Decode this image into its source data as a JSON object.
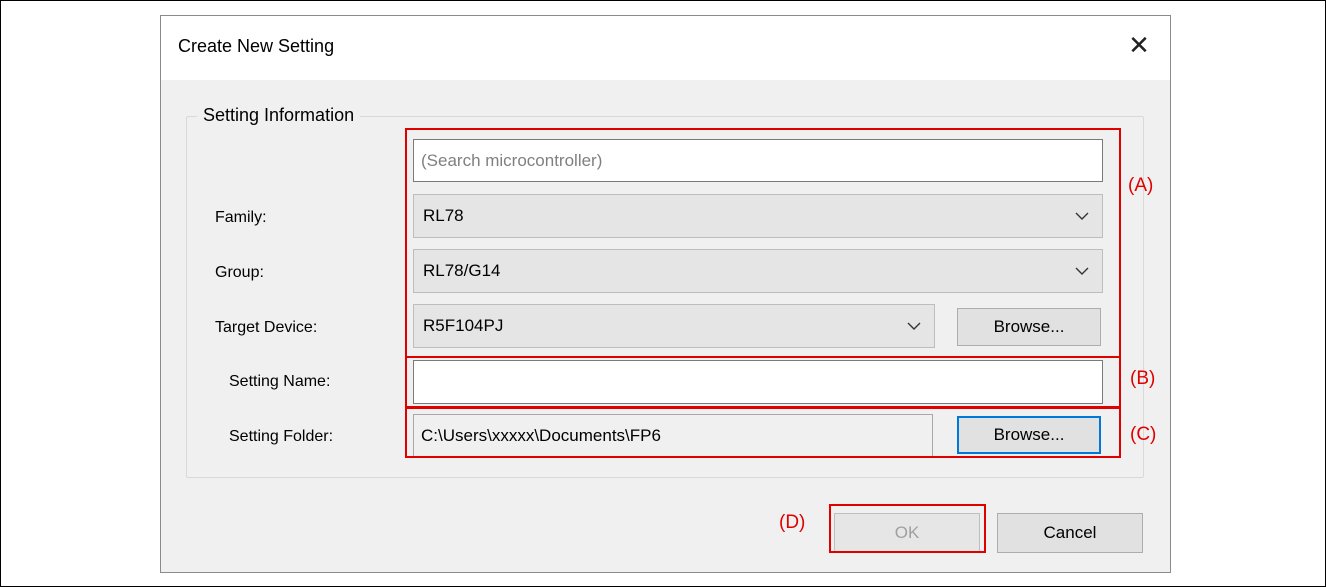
{
  "dialog": {
    "title": "Create New Setting",
    "close_glyph": "✕"
  },
  "setting_info": {
    "group_label": "Setting Information",
    "search": {
      "placeholder": "(Search microcontroller)",
      "value": ""
    },
    "family": {
      "label": "Family:",
      "value": "RL78"
    },
    "group": {
      "label": "Group:",
      "value": "RL78/G14"
    },
    "target_device": {
      "label": "Target Device:",
      "value": "R5F104PJ",
      "browse_label": "Browse..."
    },
    "setting_name": {
      "label": "Setting Name:",
      "value": ""
    },
    "setting_folder": {
      "label": "Setting Folder:",
      "value": "C:\\Users\\xxxxx\\Documents\\FP6",
      "browse_label": "Browse..."
    }
  },
  "footer": {
    "ok_label": "OK",
    "cancel_label": "Cancel"
  },
  "annotations": {
    "a": "(A)",
    "b": "(B)",
    "c": "(C)",
    "d": "(D)",
    "color": "#e00000"
  },
  "icons": {
    "close": "close-icon",
    "dropdown": "chevron-down-icon"
  }
}
